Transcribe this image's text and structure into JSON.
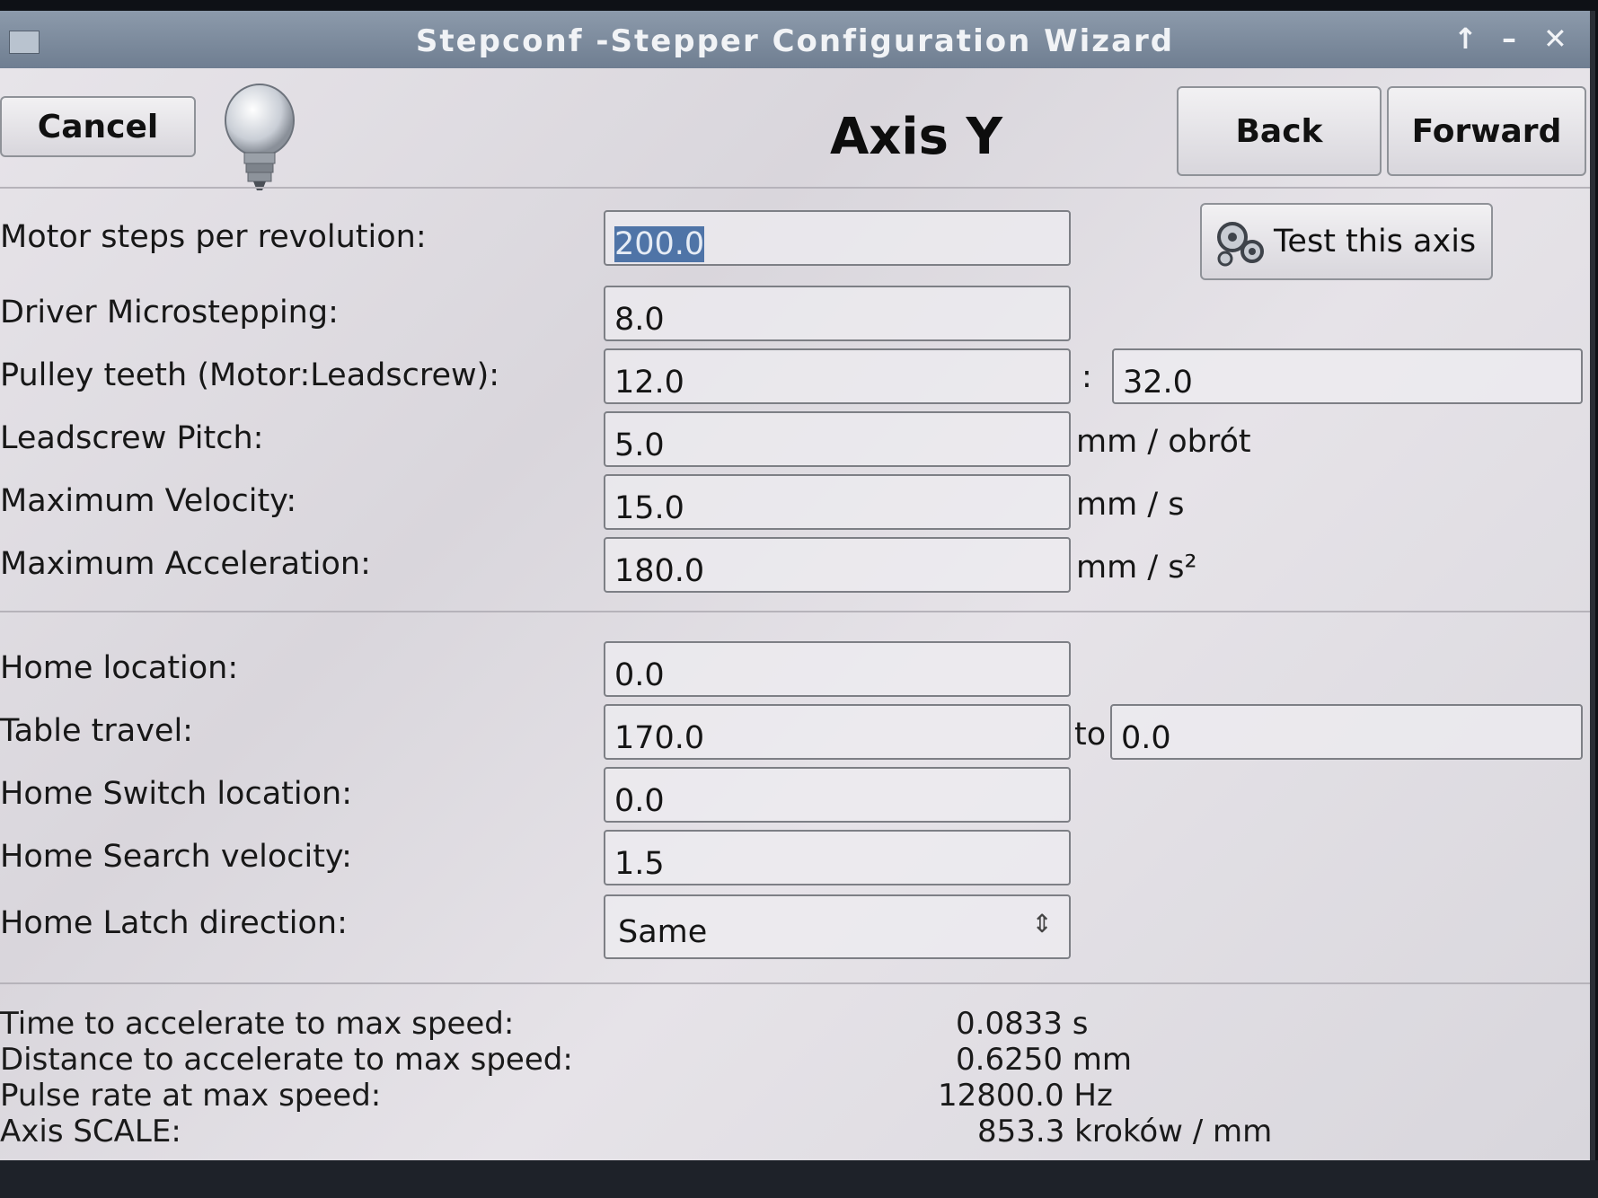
{
  "window": {
    "title": "Stepconf -Stepper Configuration Wizard",
    "controls": {
      "up": "↑",
      "minimize": "–",
      "close": "✕"
    }
  },
  "toolbar": {
    "cancel_label": "Cancel",
    "back_label": "Back",
    "forward_label": "Forward",
    "page_title": "Axis Y",
    "test_axis_label": "Test this axis"
  },
  "motor": {
    "steps_per_rev": {
      "label": "Motor steps per revolution:",
      "value": "200.0"
    },
    "microstepping": {
      "label": "Driver Microstepping:",
      "value": "8.0"
    },
    "pulley": {
      "label": "Pulley teeth (Motor:Leadscrew):",
      "motor": "12.0",
      "separator": ":",
      "leadscrew": "32.0"
    },
    "pitch": {
      "label": "Leadscrew Pitch:",
      "value": "5.0",
      "unit": "mm / obrót"
    },
    "max_velocity": {
      "label": "Maximum Velocity:",
      "value": "15.0",
      "unit": "mm / s"
    },
    "max_accel": {
      "label": "Maximum Acceleration:",
      "value": "180.0",
      "unit": "mm / s²"
    }
  },
  "homing": {
    "home_location": {
      "label": "Home location:",
      "value": "0.0"
    },
    "table_travel": {
      "label": "Table travel:",
      "from": "170.0",
      "to_label": "to",
      "to": "0.0"
    },
    "home_switch": {
      "label": "Home Switch location:",
      "value": "0.0"
    },
    "search_velocity": {
      "label": "Home Search velocity:",
      "value": "1.5"
    },
    "latch_direction": {
      "label": "Home Latch direction:",
      "value": "Same"
    }
  },
  "stats": {
    "accel_time": {
      "label": "Time to accelerate to max speed:",
      "value": "0.0833 s"
    },
    "accel_distance": {
      "label": "Distance to accelerate to max speed:",
      "value": "0.6250 mm"
    },
    "pulse_rate": {
      "label": "Pulse rate at max speed:",
      "value": "12800.0 Hz"
    },
    "axis_scale": {
      "label": "Axis SCALE:",
      "value": "853.3 kroków / mm"
    }
  },
  "icons": {
    "window_menu": "window-menu-icon",
    "hint": "lightbulb-icon",
    "test": "gears-icon",
    "select": "updown-arrows-icon"
  }
}
